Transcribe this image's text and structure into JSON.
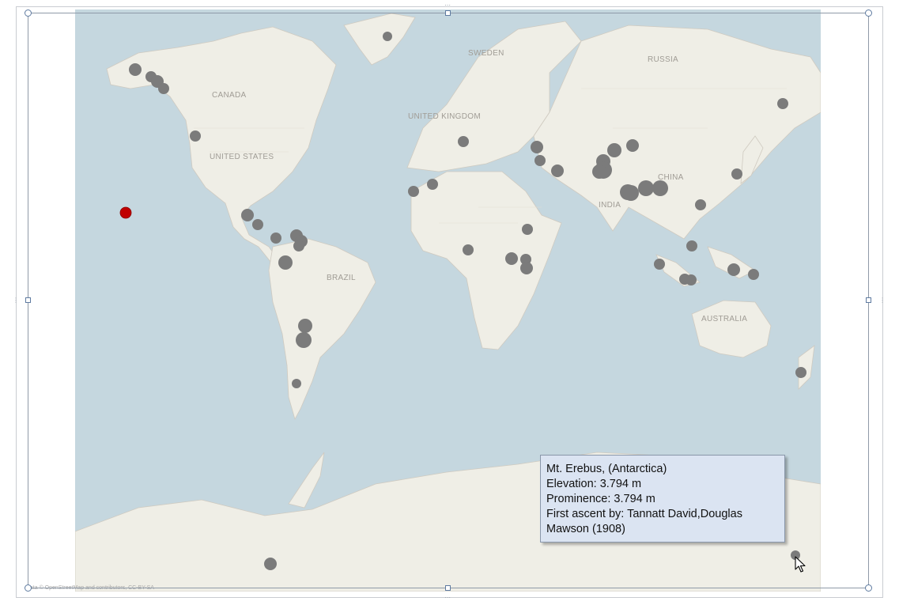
{
  "map": {
    "country_labels": [
      {
        "id": "canada",
        "text": "CANADA"
      },
      {
        "id": "united-states",
        "text": "UNITED STATES"
      },
      {
        "id": "brazil",
        "text": "BRAZIL"
      },
      {
        "id": "sweden",
        "text": "SWEDEN"
      },
      {
        "id": "united-kingdom",
        "text": "UNITED KINGDOM"
      },
      {
        "id": "russia",
        "text": "RUSSIA"
      },
      {
        "id": "china",
        "text": "CHINA"
      },
      {
        "id": "india",
        "text": "INDIA"
      },
      {
        "id": "australia",
        "text": "AUSTRALIA"
      }
    ],
    "attribution": "data © OpenStreetMap and contributors, CC-BY-SA",
    "colors": {
      "ocean": "#c5d7df",
      "land": "#efeee6",
      "marker": "#7b7b7b",
      "selected_marker": "#c00000"
    }
  },
  "tooltip": {
    "name": "Mt. Erebus, (Antarctica)",
    "elevation": "Elevation:  3.794 m",
    "prominence": "Prominence:  3.794 m",
    "first_ascent_line1": "First ascent by: Tannatt  David,Douglas",
    "first_ascent_line2": "Mawson  (1908)"
  },
  "icons": {
    "cursor": "mouse-pointer-icon"
  }
}
